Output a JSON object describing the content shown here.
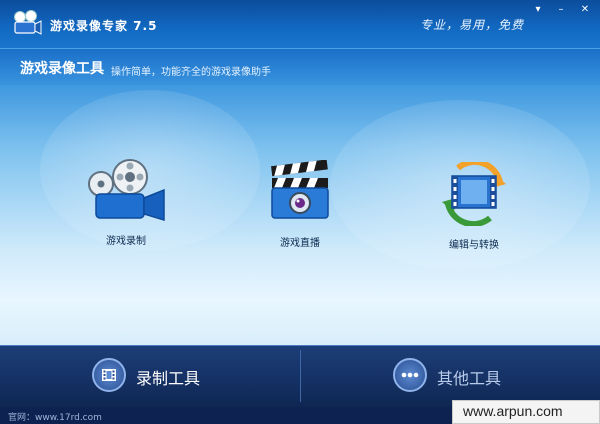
{
  "app": {
    "title": "游戏录像专家 7.5",
    "slogan": "专业，易用，免费"
  },
  "window_controls": {
    "menu": "▾",
    "minimize": "–",
    "close": "✕"
  },
  "header": {
    "title": "游戏录像工具",
    "description": "操作简单，功能齐全的游戏录像助手"
  },
  "tools": [
    {
      "label": "游戏录制",
      "icon": "camera-icon"
    },
    {
      "label": "游戏直播",
      "icon": "clapperboard-icon"
    },
    {
      "label": "编辑与转换",
      "icon": "film-convert-icon"
    }
  ],
  "bottom_tabs": [
    {
      "label": "录制工具",
      "icon": "film-strip-icon",
      "active": true
    },
    {
      "label": "其他工具",
      "icon": "more-dots-icon",
      "active": false
    }
  ],
  "footer": {
    "website_label": "官网：www.17rd.com"
  },
  "watermark": "www.arpun.com"
}
